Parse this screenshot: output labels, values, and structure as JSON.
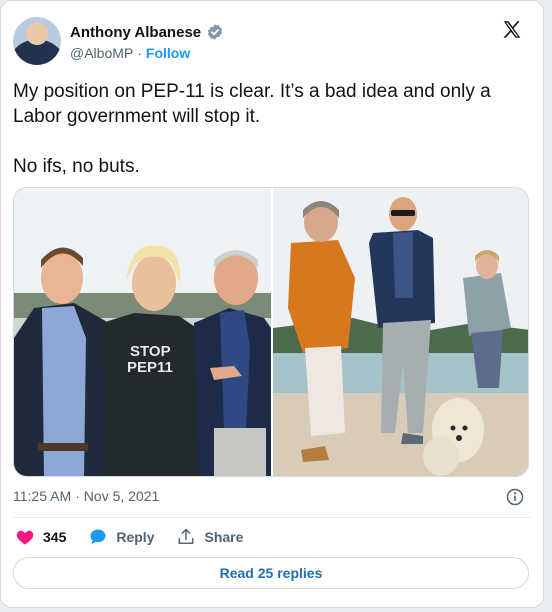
{
  "author": {
    "display_name": "Anthony Albanese",
    "handle": "@AlboMP",
    "separator": "·",
    "follow_label": "Follow"
  },
  "tweet": {
    "text": "My position on PEP-11 is clear. It’s a bad idea and only a Labor government will stop it.\n\nNo ifs, no buts."
  },
  "media": {
    "left_photo_shirt_text_line1": "STOP",
    "left_photo_shirt_text_line2": "PEP11"
  },
  "meta": {
    "time": "11:25 AM",
    "separator": "·",
    "date": "Nov 5, 2021"
  },
  "actions": {
    "like_count": "345",
    "reply_label": "Reply",
    "share_label": "Share"
  },
  "footer": {
    "read_replies_label": "Read 25 replies"
  },
  "colors": {
    "accent": "#1d9bf0",
    "like": "#f91880",
    "text": "#0f1419",
    "secondary": "#536471"
  },
  "icons": [
    "verified-badge-icon",
    "x-logo-icon",
    "info-icon",
    "heart-icon",
    "reply-bubble-icon",
    "share-icon"
  ]
}
